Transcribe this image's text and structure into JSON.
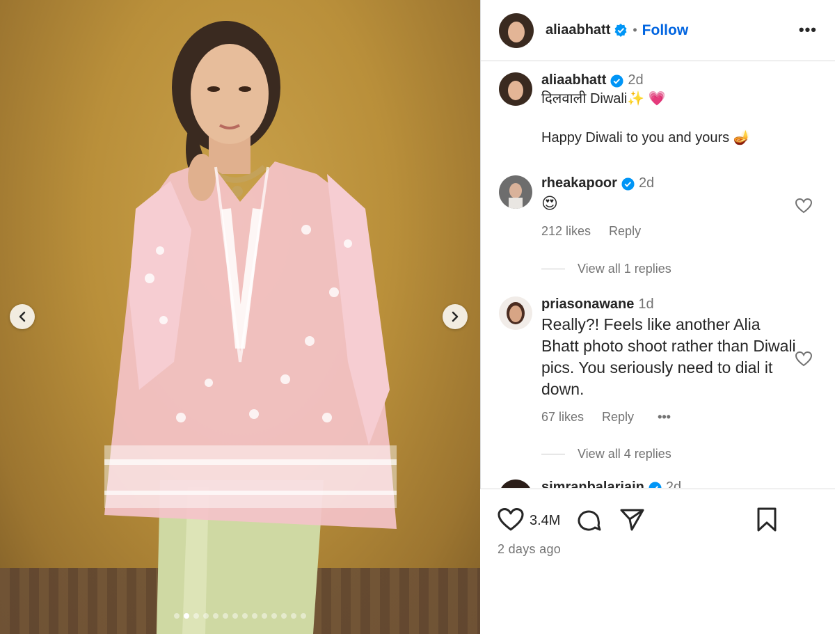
{
  "post": {
    "author": "aliaabhatt",
    "follow_label": "Follow",
    "separator": "•",
    "more_label": "•••",
    "caption_time": "2d",
    "caption_line1": "दिलवाली Diwali✨ 💗",
    "caption_line2": "Happy Diwali to you and yours 🪔",
    "likes": "3.4M",
    "posted": "2 days ago",
    "carousel_total": 14,
    "carousel_active": 2
  },
  "comments": [
    {
      "user": "rheakapoor",
      "time": "2d",
      "text": "😍",
      "likes": "212 likes",
      "reply": "Reply",
      "view_replies": "View all 1 replies"
    },
    {
      "user": "priasonawane",
      "time": "1d",
      "text": "Really?! Feels like another Alia Bhatt photo shoot rather than Diwali pics. You seriously need to dial it down.",
      "likes": "67 likes",
      "reply": "Reply",
      "more": "•••",
      "view_replies": "View all 4 replies"
    },
    {
      "user": "simranbalarjain",
      "time": "2d"
    }
  ],
  "colors": {
    "accent": "#0064e0",
    "verified": "#0095f6",
    "text": "#262626",
    "muted": "#737373"
  },
  "icons": [
    "chevron-left-icon",
    "chevron-right-icon",
    "verified-icon",
    "more-icon",
    "heart-icon",
    "comment-icon",
    "share-icon",
    "bookmark-icon"
  ]
}
